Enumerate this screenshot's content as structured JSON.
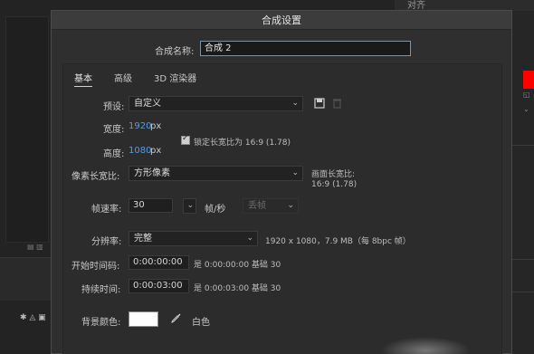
{
  "background": {
    "panel_label": "对齐"
  },
  "dialog": {
    "title": "合成设置",
    "name_label": "合成名称:",
    "name_value": "合成 2",
    "tabs": [
      "基本",
      "高级",
      "3D 渲染器"
    ],
    "preset_label": "预设:",
    "preset_value": "自定义",
    "width_label": "宽度:",
    "width_value": "1920",
    "width_unit": "px",
    "height_label": "高度:",
    "height_value": "1080",
    "height_unit": "px",
    "lock_label": "锁定长宽比为 16:9 (1.78)",
    "pixel_aspect_label": "像素长宽比:",
    "pixel_aspect_value": "方形像素",
    "frame_aspect_label": "画面长宽比:",
    "frame_aspect_value": "16:9 (1.78)",
    "framerate_label": "帧速率:",
    "framerate_value": "30",
    "framerate_unit": "帧/秒",
    "drop_frame_value": "丢帧",
    "resolution_label": "分辨率:",
    "resolution_value": "完整",
    "resolution_info": "1920 x 1080，7.9 MB（每 8bpc 帧）",
    "start_tc_label": "开始时间码:",
    "start_tc_value": "0:00:00:00",
    "start_tc_info": "是 0:00:00:00 基础 30",
    "duration_label": "持续时间:",
    "duration_value": "0:00:03:00",
    "duration_info": "是 0:00:03:00 基础 30",
    "bg_color_label": "背景颜色:",
    "bg_color_name": "白色",
    "bg_color_hex": "#ffffff"
  }
}
